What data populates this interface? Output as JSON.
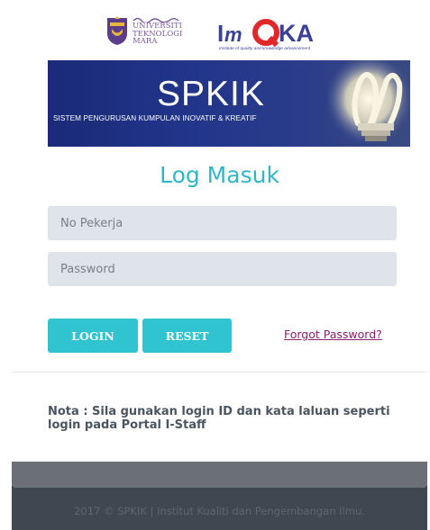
{
  "branding": {
    "uitm_lines": [
      "UNIVERSITI",
      "TEKNOLOGI",
      "MARA"
    ],
    "imqka_name": "ImQKA",
    "imqka_tagline": "Institute of quality and knowledge advancement"
  },
  "banner": {
    "title": "SPKIK",
    "subtitle": "SISTEM PENGURUSAN KUMPULAN INOVATIF & KREATIF"
  },
  "form": {
    "heading": "Log Masuk",
    "username_placeholder": "No Pekerja",
    "password_placeholder": "Password",
    "login_label": "LOGIN",
    "reset_label": "RESET",
    "forgot_label": "Forgot Password?"
  },
  "note": "Nota : Sila gunakan login ID dan kata laluan seperti login pada Portal I-Staff",
  "footer": "2017 © SPKIK | Institut Kualiti dan Pengembangan Ilmu.",
  "colors": {
    "accent": "#2fc4cf",
    "heading": "#2fb6c8",
    "link": "#8a1f6a",
    "banner": "#22358a",
    "footer_bg": "#3f4750"
  }
}
